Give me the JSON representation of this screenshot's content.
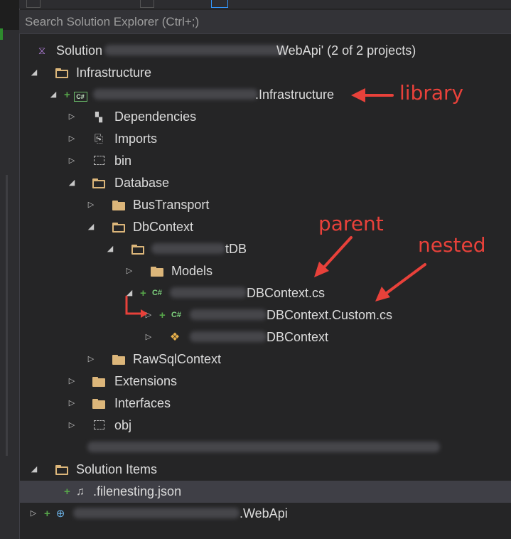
{
  "search": {
    "placeholder": "Search Solution Explorer (Ctrl+;)"
  },
  "solution": {
    "prefix": "Solution",
    "suffix": "WebApi' (2 of 2 projects)"
  },
  "tree": {
    "infrastructure_folder": "Infrastructure",
    "infra_project_suffix": ".Infrastructure",
    "dependencies": "Dependencies",
    "imports": "Imports",
    "bin": "bin",
    "database": "Database",
    "bus_transport": "BusTransport",
    "dbcontext_folder": "DbContext",
    "db_folder_suffix": "tDB",
    "models": "Models",
    "dbcontext_cs": "DBContext.cs",
    "dbcontext_custom_cs": "DBContext.Custom.cs",
    "dbcontext_class": "DBContext",
    "raw_sql_context": "RawSqlContext",
    "extensions": "Extensions",
    "interfaces": "Interfaces",
    "obj": "obj",
    "solution_items": "Solution Items",
    "filenesting": ".filenesting.json",
    "webapi_suffix": ".WebApi"
  },
  "icons": {
    "project": "csharp-project-icon",
    "file": "csharp-file-icon",
    "folder": "folder-icon"
  },
  "annotations": {
    "library": "library",
    "parent": "parent",
    "nested": "nested"
  },
  "colors": {
    "annotation": "#e8413a",
    "added": "#57a64a",
    "folder": "#dcb67a"
  }
}
